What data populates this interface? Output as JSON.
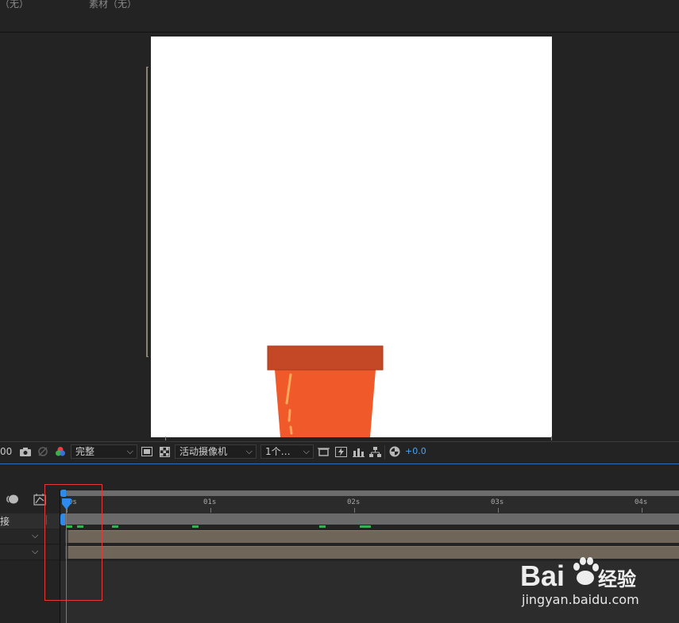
{
  "top_panel": {
    "label_left": "（无）",
    "label_right": "素材（无）"
  },
  "viewer_toolbar": {
    "zoom_fragment": "00",
    "resolution": "完整",
    "camera": "活动摄像机",
    "views": "1个…",
    "exposure": "+0.0"
  },
  "timeline": {
    "ruler_ticks": [
      "0s",
      "01s",
      "02s",
      "03s",
      "04s"
    ],
    "row_0_label": "接",
    "work_area_color": "#6c6c6c",
    "playhead_color": "#2d8ceb",
    "layer_bar_color": "#6f6659",
    "marker_color": "#35b24b"
  },
  "annotation": {
    "highlight_color": "#e03a3a"
  },
  "watermark": {
    "logo_text": "Bai 经验",
    "url": "jingyan.baidu.com"
  }
}
